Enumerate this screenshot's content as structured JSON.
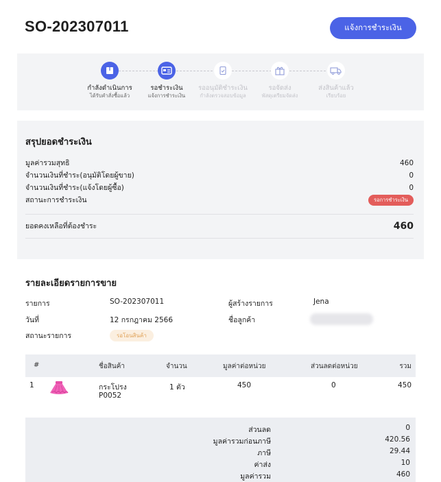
{
  "header": {
    "order_id": "SO-202307011",
    "notify_button": "แจ้งการชำระเงิน"
  },
  "stepper": {
    "steps": [
      {
        "label": "กำลังดำเนินการ",
        "sub": "ได้รับคำสั่งซื้อแล้ว",
        "icon": "box-icon",
        "state": "active"
      },
      {
        "label": "รอชำระเงิน",
        "sub": "แจ้งการชำระเงิน",
        "icon": "payment-card-icon",
        "state": "active"
      },
      {
        "label": "รออนุมัติชำระเงิน",
        "sub": "กำลังตรวจสอบข้อมูล",
        "icon": "document-check-icon",
        "state": "inactive"
      },
      {
        "label": "รอจัดส่ง",
        "sub": "พัสดุเตรียมจัดส่ง",
        "icon": "gift-box-icon",
        "state": "inactive"
      },
      {
        "label": "ส่งสินค้าแล้ว",
        "sub": "เรียบร้อย",
        "icon": "truck-icon",
        "state": "inactive"
      }
    ],
    "active_color": "#4b63e6"
  },
  "summary": {
    "title": "สรุปยอดชำระเงิน",
    "rows": [
      {
        "label": "มูลค่ารวมสุทธิ",
        "value": "460"
      },
      {
        "label": "จำนวนเงินที่ชำระ(อนุมัติโดยผู้ขาย)",
        "value": "0"
      },
      {
        "label": "จำนวนเงินที่ชำระ(แจ้งโดยผู้ซื้อ)",
        "value": "0"
      }
    ],
    "status_label": "สถานะการชำระเงิน",
    "status_badge": "รอการชำระเงิน",
    "status_color": "#e35d5b",
    "balance_label": "ยอดคงเหลือที่ต้องชำระ",
    "balance_value": "460"
  },
  "details": {
    "title": "รายละเอียดรายการขาย",
    "item_label": "รายการ",
    "item_value": "SO-202307011",
    "date_label": "วันที่",
    "date_value": "12 กรกฎาคม 2566",
    "status_label": "สถานะรายการ",
    "status_value": "รอโอนสินค้า",
    "creator_label": "ผู้สร้างรายการ",
    "creator_value": "Jena",
    "customer_label": "ชื่อลูกค้า"
  },
  "table": {
    "headers": [
      "#",
      "ชื่อสินค้า",
      "จำนวน",
      "มูลค่าต่อหน่วย",
      "ส่วนลดต่อหน่วย",
      "รวม"
    ],
    "rows": [
      {
        "no": "1",
        "name_line1": "กระโปรง",
        "name_line2": "P0052",
        "qty": "1 ตัว",
        "unit_price": "450",
        "unit_discount": "0",
        "total": "450",
        "image": "pink-skirt-image"
      }
    ],
    "totals": [
      {
        "label": "ส่วนลด",
        "value": "0"
      },
      {
        "label": "มูลค่ารวมก่อนภาษี",
        "value": "420.56"
      },
      {
        "label": "ภาษี",
        "value": "29.44"
      },
      {
        "label": "ค่าส่ง",
        "value": "10"
      },
      {
        "label": "มูลค่ารวม",
        "value": "460"
      }
    ]
  }
}
